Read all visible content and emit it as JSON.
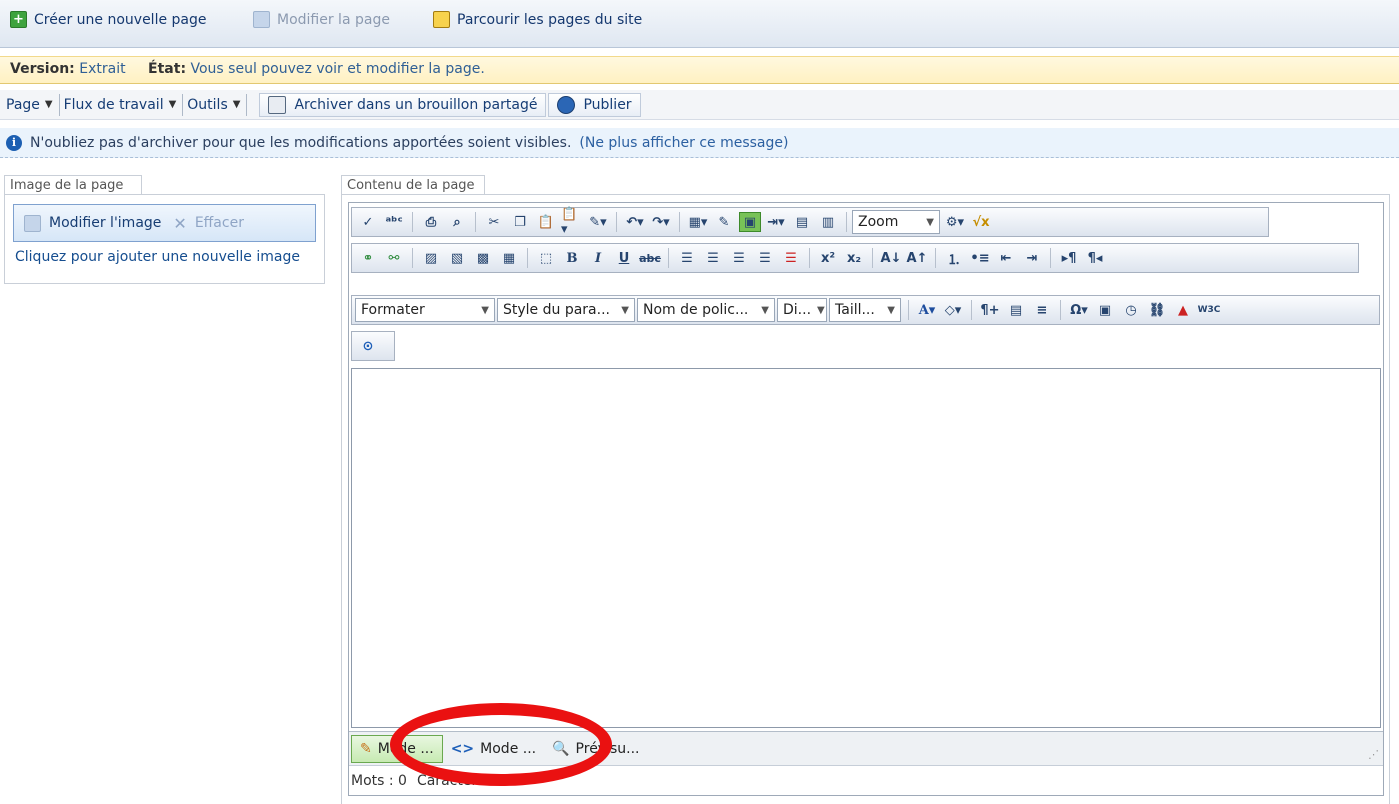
{
  "ribbon": {
    "create_page": "Créer une nouvelle page",
    "edit_page": "Modifier la page",
    "browse_pages": "Parcourir les pages du site"
  },
  "version_bar": {
    "version_label": "Version:",
    "version_value": "Extrait",
    "state_label": "État:",
    "state_value": "Vous seul pouvez voir et modifier la page."
  },
  "page_toolbar": {
    "page_menu": "Page",
    "workflow_menu": "Flux de travail",
    "tools_menu": "Outils",
    "checkin_button": "Archiver dans un brouillon partagé",
    "publish_button": "Publier"
  },
  "notice": {
    "message": "N'oubliez pas d'archiver pour que les modifications apportées soient visibles.",
    "dismiss_link": "(Ne plus afficher ce message)"
  },
  "page_image": {
    "section_title": "Image de la page",
    "edit_image": "Modifier l'image",
    "clear": "Effacer",
    "add_image_link": "Cliquez pour ajouter une nouvelle image"
  },
  "page_content": {
    "section_title": "Contenu de la page",
    "dropdowns": {
      "format": "Formater",
      "paragraph_style": "Style du para...",
      "font_name": "Nom de polic...",
      "dimension": "Di...",
      "size": "Taill...",
      "zoom": "Zoom"
    },
    "modes": {
      "design": "Mode ...",
      "html": "Mode ...",
      "preview": "Prévisu..."
    },
    "status": {
      "words": "Mots : 0",
      "chars": "Caractères : 0"
    }
  },
  "icons": {
    "row1": [
      "spellcheck-icon",
      "abc-check-icon",
      "print-icon",
      "find-icon",
      "cut-icon",
      "copy-icon",
      "paste-icon",
      "paste-options-icon",
      "format-painter-icon",
      "undo-icon",
      "redo-icon",
      "table-icon",
      "edit-table-icon",
      "template-icon",
      "insert-row-icon",
      "grid-icon",
      "columns-icon",
      "tools-icon",
      "formula-icon"
    ],
    "row2": [
      "link-icon",
      "unlink-icon",
      "image-icon",
      "image-map-icon",
      "gallery-icon",
      "media-icon",
      "select-all-icon",
      "bold-icon",
      "italic-icon",
      "underline-icon",
      "strike-icon",
      "align-left-icon",
      "align-center-icon",
      "align-right-icon",
      "justify-icon",
      "clear-format-icon",
      "superscript-icon",
      "subscript-icon",
      "font-size-down-icon",
      "font-size-up-icon",
      "ordered-list-icon",
      "unordered-list-icon",
      "outdent-icon",
      "indent-icon",
      "ltr-icon",
      "rtl-icon"
    ],
    "row3": [
      "font-color-icon",
      "highlight-icon",
      "paragraph-icon",
      "insert-date-icon",
      "justify-block-icon",
      "symbol-icon",
      "page-icon",
      "clock-icon",
      "hyperlink-icon",
      "bookmark-icon",
      "w3c-icon"
    ]
  }
}
